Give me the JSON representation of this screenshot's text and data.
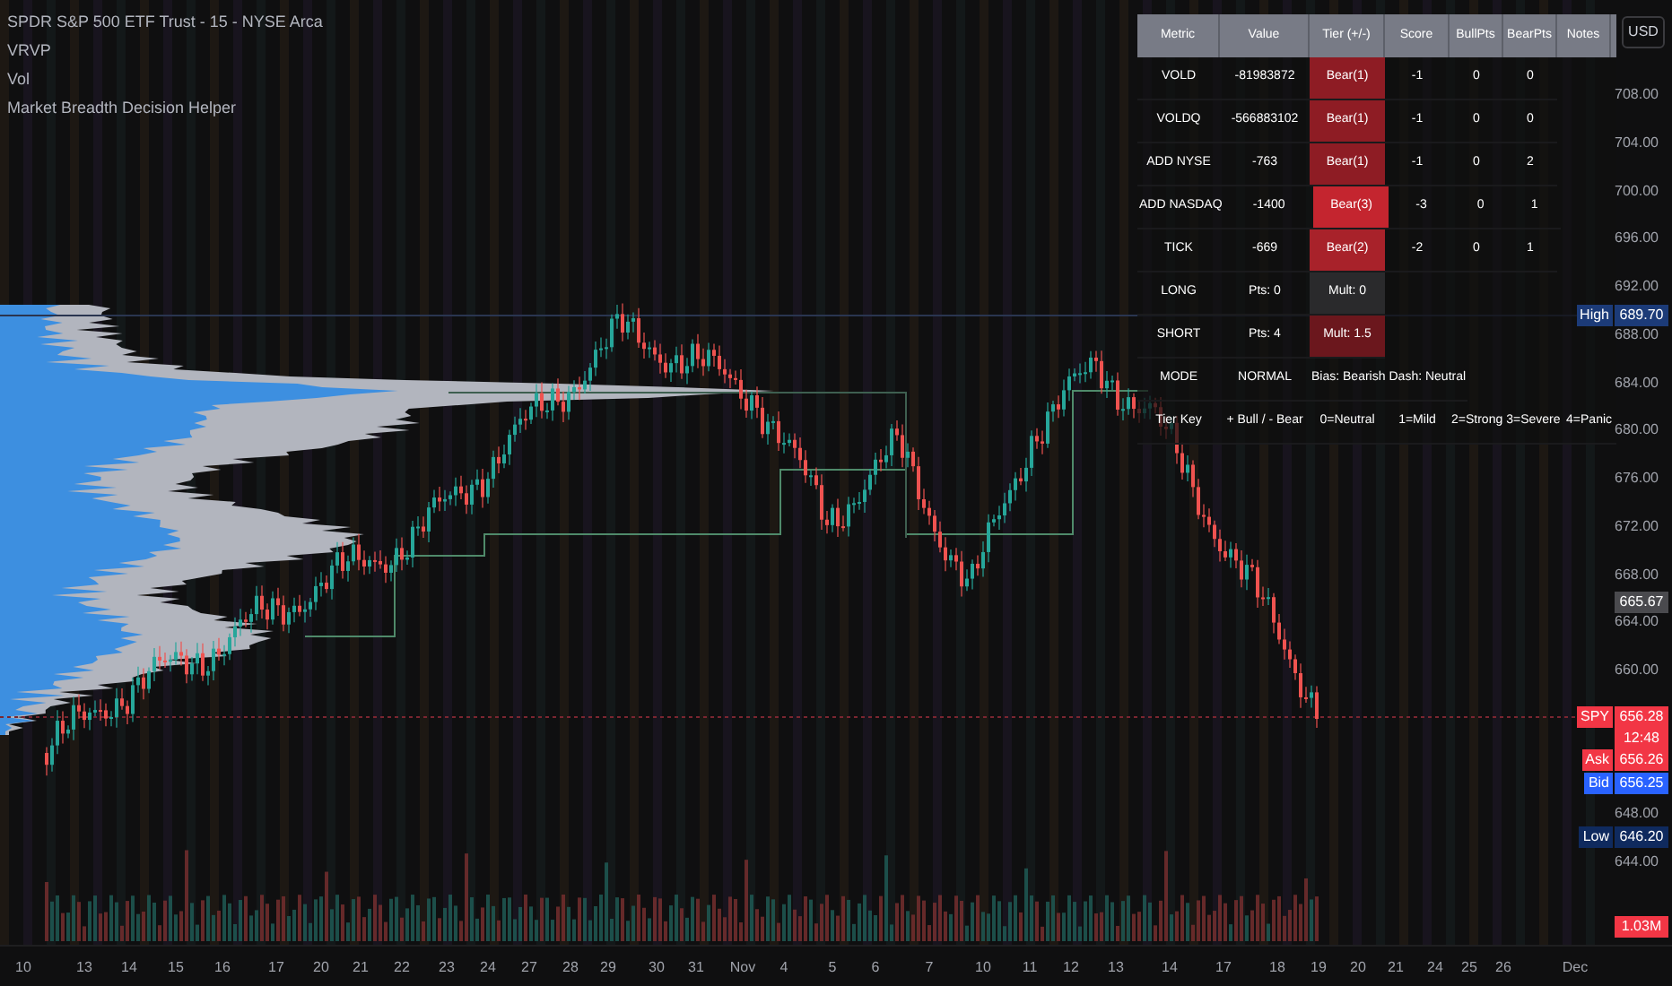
{
  "legend": [
    "SPDR S&P 500 ETF Trust - 15 - NYSE Arca",
    "VRVP",
    "Vol",
    "Market Breadth Decision Helper"
  ],
  "currency_button": "USD",
  "table": {
    "columns": [
      "Metric",
      "Value",
      "Tier (+/-)",
      "Score",
      "BullPts",
      "BearPts",
      "Notes"
    ],
    "rows": [
      {
        "cells": [
          {
            "text": "VOLD"
          },
          {
            "text": "-81983872"
          },
          {
            "text": "Bear(1)",
            "color": "#8e1c24"
          },
          {
            "text": "-1"
          },
          {
            "text": "0"
          },
          {
            "text": "0"
          }
        ]
      },
      {
        "cells": [
          {
            "text": "VOLDQ"
          },
          {
            "text": "-566883102"
          },
          {
            "text": "Bear(1)",
            "color": "#8e1c24"
          },
          {
            "text": "-1"
          },
          {
            "text": "0"
          },
          {
            "text": "0"
          }
        ]
      },
      {
        "cells": [
          {
            "text": "ADD NYSE"
          },
          {
            "text": "-763"
          },
          {
            "text": "Bear(1)",
            "color": "#8e1c24"
          },
          {
            "text": "-1"
          },
          {
            "text": "0"
          },
          {
            "text": "2"
          }
        ]
      },
      {
        "cells": [
          {
            "text": "ADD NASDAQ"
          },
          {
            "text": "-1400"
          },
          {
            "text": "Bear(3)",
            "color": "#c4252f"
          },
          {
            "text": "-3"
          },
          {
            "text": "0"
          },
          {
            "text": "1"
          }
        ]
      },
      {
        "cells": [
          {
            "text": "TICK"
          },
          {
            "text": "-669"
          },
          {
            "text": "Bear(2)",
            "color": "#a8222a"
          },
          {
            "text": "-2"
          },
          {
            "text": "0"
          },
          {
            "text": "1"
          }
        ]
      },
      {
        "cells": [
          {
            "text": "LONG"
          },
          {
            "text": "Pts: 0"
          },
          {
            "text": "Mult: 0",
            "color": "#2a2a2c"
          }
        ]
      },
      {
        "cells": [
          {
            "text": "SHORT"
          },
          {
            "text": "Pts: 4"
          },
          {
            "text": "Mult: 1.5",
            "color": "#6b171d"
          }
        ]
      },
      {
        "cells": [
          {
            "text": "MODE"
          },
          {
            "text": "NORMAL"
          },
          {
            "text": "Bias: Bearish"
          },
          {
            "text": "Dash: Neutral"
          }
        ]
      },
      {
        "cells": [
          {
            "text": "Tier Key"
          },
          {
            "text": "+ Bull / - Bear"
          },
          {
            "text": "0=Neutral"
          },
          {
            "text": "1=Mild"
          },
          {
            "text": "2=Strong"
          },
          {
            "text": "3=Severe"
          },
          {
            "text": "4=Panic"
          }
        ]
      }
    ]
  },
  "price_axis": [
    "708.00",
    "704.00",
    "700.00",
    "696.00",
    "692.00",
    "688.00",
    "684.00",
    "680.00",
    "676.00",
    "672.00",
    "668.00",
    "664.00",
    "660.00",
    "648.00",
    "644.00"
  ],
  "price_tags": [
    {
      "label": "High",
      "value": "689.70",
      "color": "#1c3b78"
    },
    {
      "value": "665.67",
      "color": "#4a4a4e"
    },
    {
      "label": "SPY",
      "value": "656.28",
      "color": "#f23645"
    },
    {
      "value": "12:48",
      "color": "#f23645"
    },
    {
      "label": "Ask",
      "value": "656.26",
      "color": "#f23645"
    },
    {
      "label": "Bid",
      "value": "656.25",
      "color": "#2962ff"
    },
    {
      "label": "Low",
      "value": "646.20",
      "color": "#0f2a5e"
    },
    {
      "value": "1.03M",
      "color": "#f23645"
    }
  ],
  "time_axis": [
    "10",
    "13",
    "14",
    "15",
    "16",
    "17",
    "20",
    "21",
    "22",
    "23",
    "24",
    "27",
    "28",
    "29",
    "30",
    "31",
    "Nov",
    "4",
    "5",
    "6",
    "7",
    "10",
    "11",
    "12",
    "13",
    "14",
    "17",
    "18",
    "19",
    "20",
    "21",
    "24",
    "25",
    "26",
    "Dec"
  ]
}
